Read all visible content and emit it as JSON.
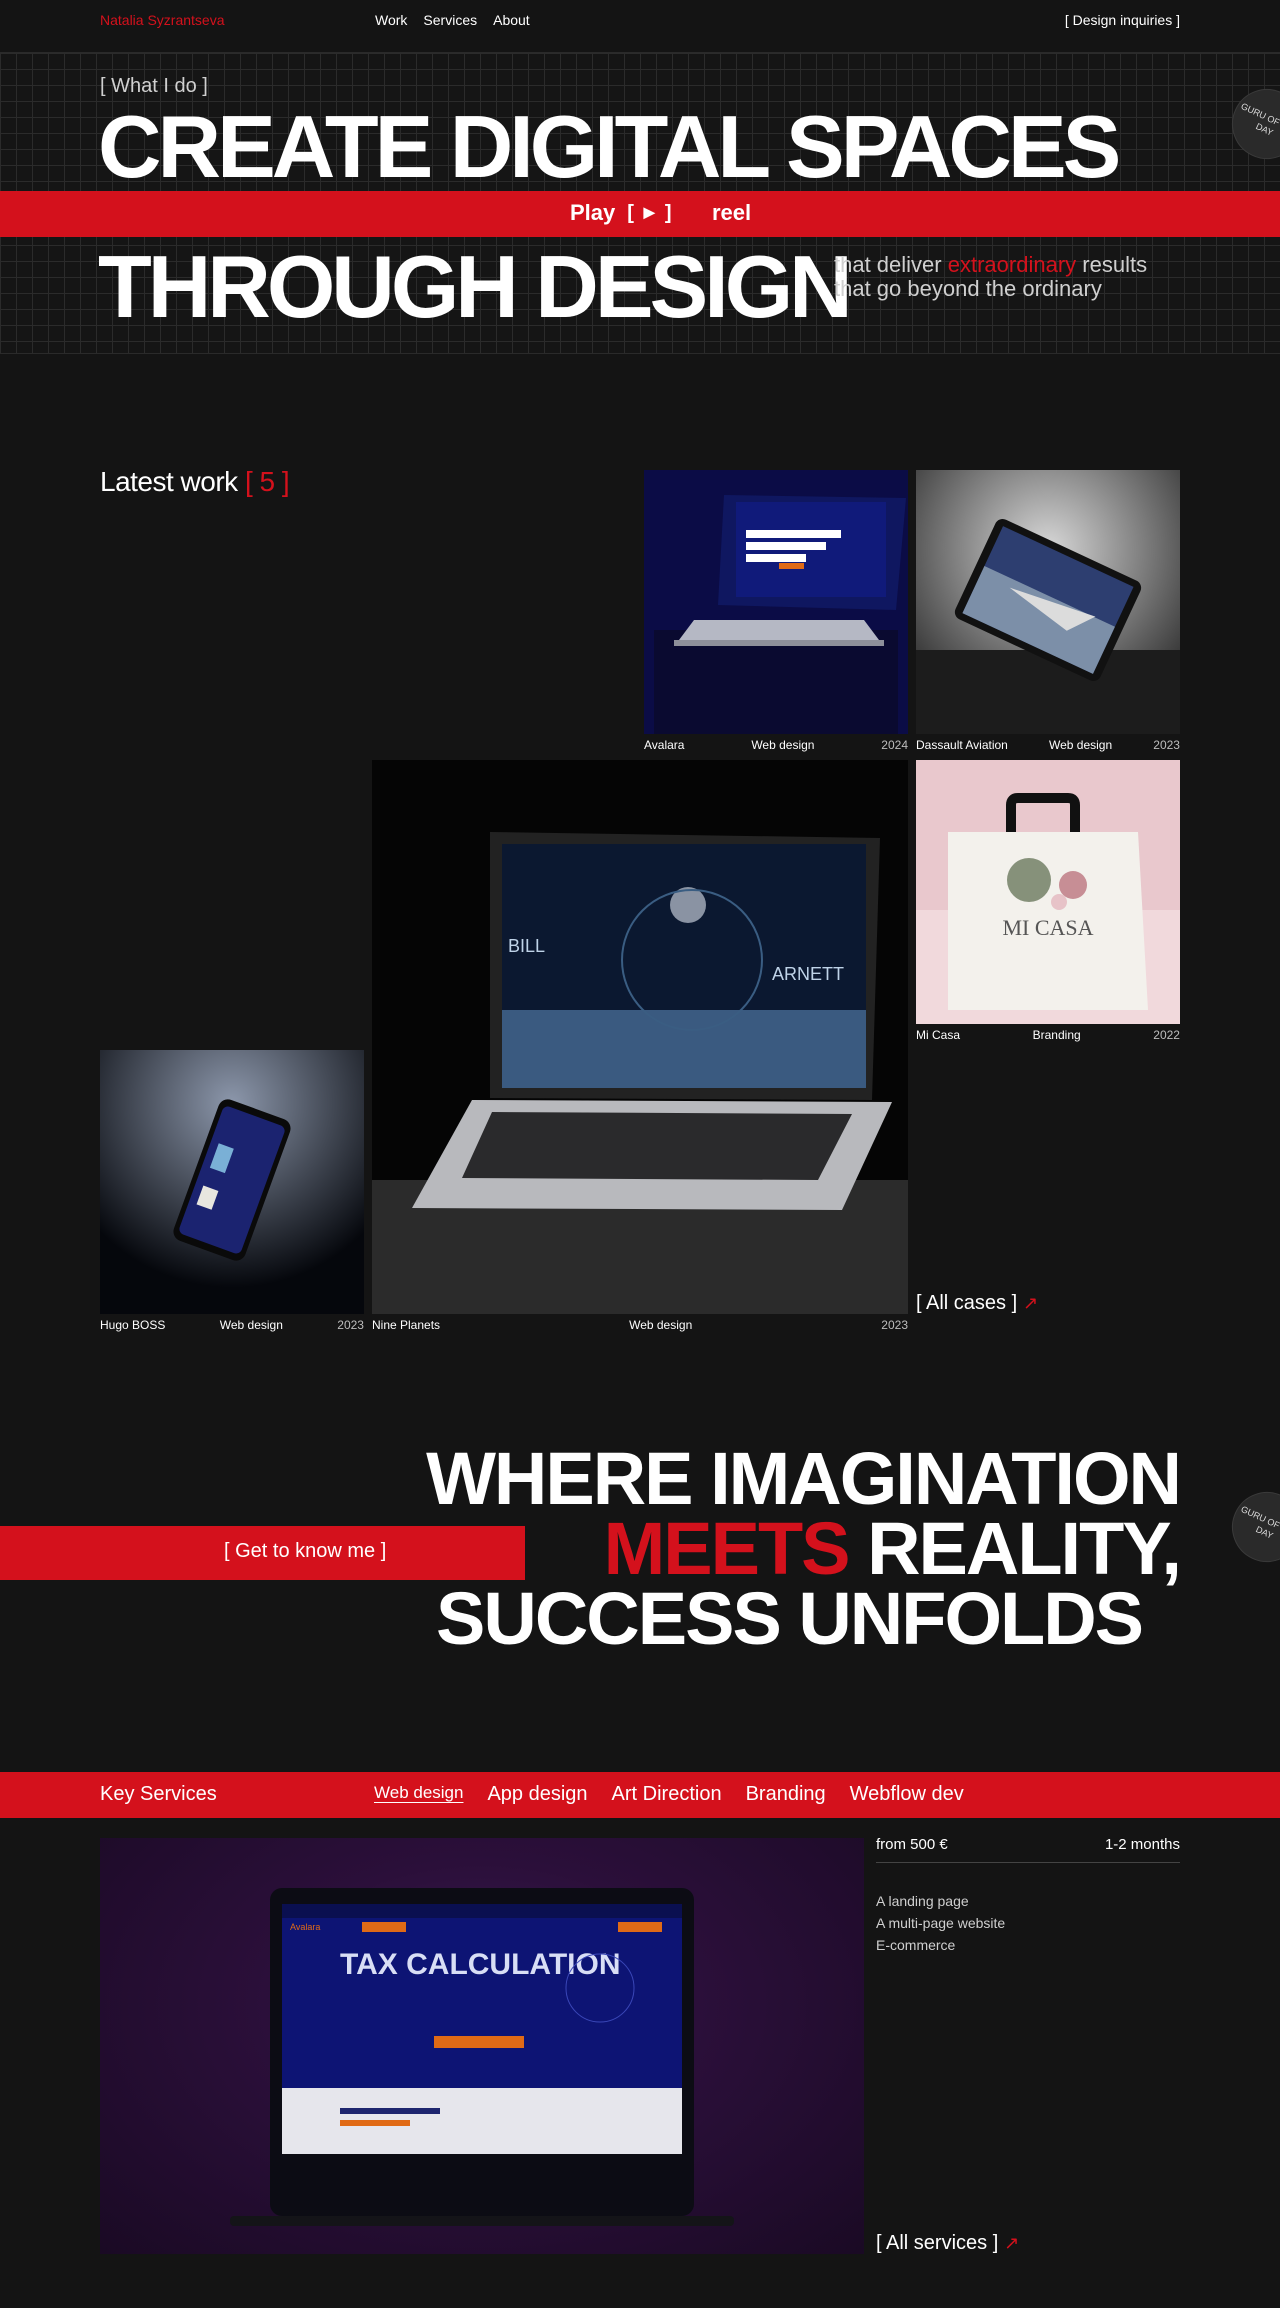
{
  "header": {
    "logo": "Natalia Syzrantseva",
    "nav": [
      "Work",
      "Services",
      "About"
    ],
    "cta": "[ Design inquiries ]"
  },
  "hero": {
    "kicker": "[ What I do ]",
    "line1": "CREATE DIGITAL SPACES",
    "play": "Play",
    "play_icon": "[ ► ]",
    "reel": "reel",
    "line2": "THROUGH DESIGN",
    "sub_prefix": "that deliver",
    "sub_accent": "extraordinary",
    "sub_suffix": "results",
    "sub_line2": "that go beyond the ordinary",
    "badge": "GURU OF THE DAY"
  },
  "latest": {
    "title": "Latest work",
    "count": "[ 5 ]",
    "cases": [
      {
        "name": "Avalara",
        "type": "Web design",
        "year": "2024"
      },
      {
        "name": "Dassault Aviation",
        "type": "Web design",
        "year": "2023"
      },
      {
        "name": "Mi Casa",
        "type": "Branding",
        "year": "2022"
      },
      {
        "name": "Nine Planets",
        "type": "Web design",
        "year": "2023"
      },
      {
        "name": "Hugo BOSS",
        "type": "Web design",
        "year": "2023"
      }
    ],
    "all_cases": "[ All cases ]"
  },
  "imagination": {
    "line1": "WHERE IMAGINATION",
    "meets": "MEETS",
    "line2_rest": "REALITY,",
    "line3": "SUCCESS UNFOLDS",
    "get_to_know": "[ Get to know me ]"
  },
  "services": {
    "title": "Key Services",
    "tabs": [
      "Web design",
      "App design",
      "Art Direction",
      "Branding",
      "Webflow dev"
    ],
    "price": "from  500 €",
    "duration": "1-2  months",
    "items": [
      "A landing page",
      "A multi-page website",
      "E-commerce"
    ],
    "all_services": "[ All services ]",
    "mock_title": "TAX CALCULATION",
    "mock_logo": "Avalara"
  },
  "colors": {
    "accent": "#d4111c",
    "background": "#141414"
  }
}
